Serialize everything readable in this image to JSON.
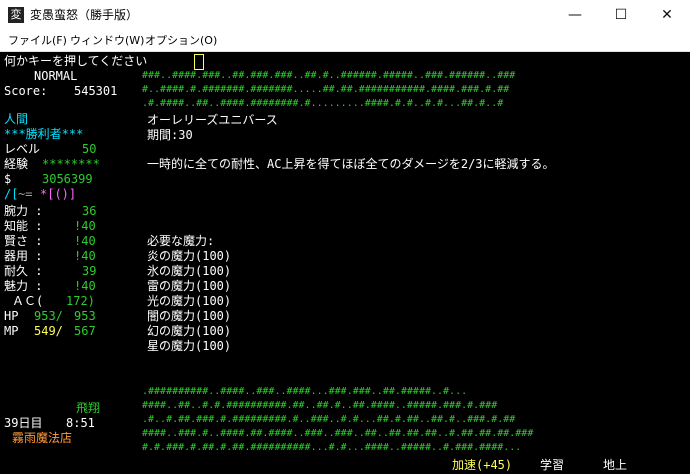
{
  "window": {
    "icon_glyph": "変",
    "title": "変愚蛮怒（勝手版）",
    "minimize": "—",
    "maximize": "☐",
    "close": "✕"
  },
  "menu": [
    "ファイル(F)",
    "ウィンドウ(W)",
    "オプション(O)"
  ],
  "prompt": "何かキーを押してください",
  "sidebar": {
    "mode": "NORMAL",
    "score_label": "Score:",
    "score_value": "545301",
    "race": "人間",
    "title": "***勝利者***",
    "level_label": "レベル",
    "level_value": "50",
    "exp_label": "経験",
    "exp_value": "********",
    "gold_label": "$",
    "gold_value": "3056399",
    "equip_prefix": "/[",
    "equip_mid": "~=",
    "equip_suffix": "*[()]",
    "stats": [
      {
        "label": "腕力 :",
        "value": "36",
        "color": "#2ecc2e"
      },
      {
        "label": "知能 :",
        "value": "!40",
        "color": "#2ecc2e"
      },
      {
        "label": "賢さ :",
        "value": "!40",
        "color": "#2ecc2e"
      },
      {
        "label": "器用 :",
        "value": "!40",
        "color": "#2ecc2e"
      },
      {
        "label": "耐久 :",
        "value": "39",
        "color": "#2ecc2e"
      },
      {
        "label": "魅力 :",
        "value": "!40",
        "color": "#2ecc2e"
      }
    ],
    "ac_label": "ＡＣ(",
    "ac_value": "172)",
    "hp_label": "HP",
    "hp_cur": "953/",
    "hp_max": "953",
    "mp_label": "MP",
    "mp_cur": "549/",
    "mp_max": "567",
    "flying": "飛翔",
    "day": "39日目",
    "time": "8:51",
    "location": "霧雨魔法店"
  },
  "main": {
    "spell_name": "オーレリーズユニバース",
    "duration": "期間:30",
    "description": "一時的に全ての耐性、AC上昇を得てほぼ全てのダメージを2/3に軽減する。",
    "required_header": "必要な魔力:",
    "required": [
      "炎の魔力(100)",
      "氷の魔力(100)",
      "雷の魔力(100)",
      "光の魔力(100)",
      "闇の魔力(100)",
      "幻の魔力(100)",
      "星の魔力(100)"
    ]
  },
  "map_top": [
    "###..####.###..##.###.###..##.#..######.#####..###.######..###",
    "#..####.#.#######.#######.....##.##.###########.####.###.#.##",
    ".#.####..##..####.########.#.........####.#.#..#.#...##.#..#"
  ],
  "map_bottom": [
    ".##########..####..###..####...###.###..##.#####..#...",
    "####..##..#.#.##########.##..##.#..##.####..#####.###.#.###",
    ".#..#.##.###.#.#########.#..###..#.#...##.#.##..##.#..###.#.##",
    "####..###.#..####.##.####..###..###..##..##.##.##..#.##.##.##.###",
    "#.#.###.#.##.#.##.##########...#.#...####..#####..#.###.####..."
  ],
  "status_bar": {
    "speed": "加速(+45)",
    "study": "学習",
    "ground": "地上"
  },
  "colors": {
    "accent_cyan": "#00e5ff",
    "terrain_green": "#2ecc2e",
    "warning_yellow": "#ffff55",
    "location_orange": "#ff9c3a"
  }
}
